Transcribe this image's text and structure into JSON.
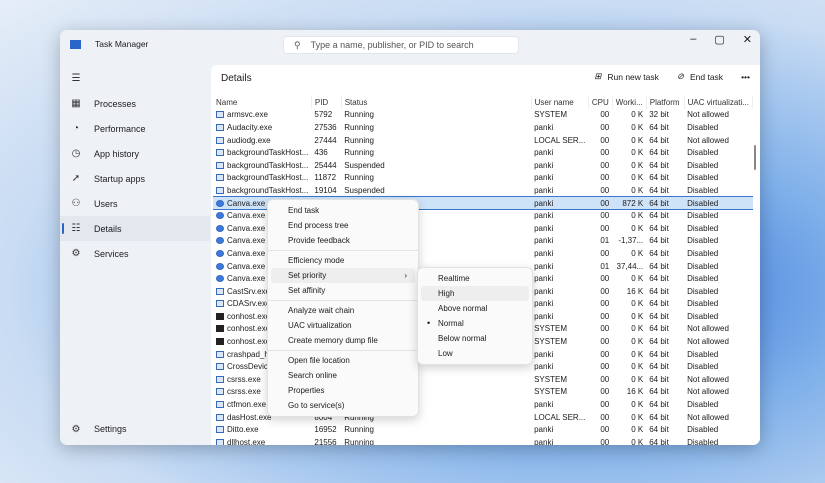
{
  "window": {
    "title": "Task Manager",
    "search_placeholder": "Type a name, publisher, or PID to search"
  },
  "sidebar": {
    "items": [
      {
        "label": "Processes",
        "icon": "grid-icon"
      },
      {
        "label": "Performance",
        "icon": "chart-icon"
      },
      {
        "label": "App history",
        "icon": "history-icon"
      },
      {
        "label": "Startup apps",
        "icon": "rocket-icon"
      },
      {
        "label": "Users",
        "icon": "users-icon"
      },
      {
        "label": "Details",
        "icon": "list-icon",
        "active": true
      },
      {
        "label": "Services",
        "icon": "gear-icon"
      }
    ],
    "settings": "Settings"
  },
  "main": {
    "title": "Details",
    "run_new_task": "Run new task",
    "end_task": "End task",
    "more": "•••"
  },
  "columns": [
    "Name",
    "PID",
    "Status",
    "User name",
    "CPU",
    "Worki...",
    "Platform",
    "UAC virtualizati..."
  ],
  "rows": [
    [
      "armsvc.exe",
      "5792",
      "Running",
      "SYSTEM",
      "00",
      "0 K",
      "32 bit",
      "Not allowed"
    ],
    [
      "Audacity.exe",
      "27536",
      "Running",
      "panki",
      "00",
      "0 K",
      "64 bit",
      "Disabled"
    ],
    [
      "audiodg.exe",
      "27444",
      "Running",
      "LOCAL SER...",
      "00",
      "0 K",
      "64 bit",
      "Not allowed"
    ],
    [
      "backgroundTaskHost...",
      "436",
      "Running",
      "panki",
      "00",
      "0 K",
      "64 bit",
      "Disabled"
    ],
    [
      "backgroundTaskHost...",
      "25444",
      "Suspended",
      "panki",
      "00",
      "0 K",
      "64 bit",
      "Disabled"
    ],
    [
      "backgroundTaskHost...",
      "11872",
      "Running",
      "panki",
      "00",
      "0 K",
      "64 bit",
      "Disabled"
    ],
    [
      "backgroundTaskHost...",
      "19104",
      "Suspended",
      "panki",
      "00",
      "0 K",
      "64 bit",
      "Disabled"
    ],
    [
      "Canva.exe",
      "",
      "",
      "panki",
      "00",
      "872 K",
      "64 bit",
      "Disabled"
    ],
    [
      "Canva.exe",
      "",
      "",
      "panki",
      "00",
      "0 K",
      "64 bit",
      "Disabled"
    ],
    [
      "Canva.exe",
      "",
      "",
      "panki",
      "00",
      "0 K",
      "64 bit",
      "Disabled"
    ],
    [
      "Canva.exe",
      "",
      "",
      "panki",
      "01",
      "-1,37...",
      "64 bit",
      "Disabled"
    ],
    [
      "Canva.exe",
      "",
      "",
      "panki",
      "00",
      "0 K",
      "64 bit",
      "Disabled"
    ],
    [
      "Canva.exe",
      "",
      "",
      "panki",
      "01",
      "37,44...",
      "64 bit",
      "Disabled"
    ],
    [
      "Canva.exe",
      "",
      "",
      "panki",
      "00",
      "0 K",
      "64 bit",
      "Disabled"
    ],
    [
      "CastSrv.exe",
      "",
      "",
      "panki",
      "00",
      "16 K",
      "64 bit",
      "Disabled"
    ],
    [
      "CDASrv.exe",
      "",
      "",
      "panki",
      "00",
      "0 K",
      "64 bit",
      "Disabled"
    ],
    [
      "conhost.exe",
      "",
      "",
      "panki",
      "00",
      "0 K",
      "64 bit",
      "Disabled"
    ],
    [
      "conhost.exe",
      "",
      "",
      "SYSTEM",
      "00",
      "0 K",
      "64 bit",
      "Not allowed"
    ],
    [
      "conhost.exe",
      "",
      "",
      "SYSTEM",
      "00",
      "0 K",
      "64 bit",
      "Not allowed"
    ],
    [
      "crashpad_h",
      "",
      "",
      "panki",
      "00",
      "0 K",
      "64 bit",
      "Disabled"
    ],
    [
      "CrossDevic",
      "",
      "",
      "panki",
      "00",
      "0 K",
      "64 bit",
      "Disabled"
    ],
    [
      "csrss.exe",
      "",
      "",
      "SYSTEM",
      "00",
      "0 K",
      "64 bit",
      "Not allowed"
    ],
    [
      "csrss.exe",
      "",
      "",
      "SYSTEM",
      "00",
      "16 K",
      "64 bit",
      "Not allowed"
    ],
    [
      "ctfmon.exe",
      "",
      "",
      "panki",
      "00",
      "0 K",
      "64 bit",
      "Disabled"
    ],
    [
      "dasHost.exe",
      "8004",
      "Running",
      "LOCAL SER...",
      "00",
      "0 K",
      "64 bit",
      "Not allowed"
    ],
    [
      "Ditto.exe",
      "16952",
      "Running",
      "panki",
      "00",
      "0 K",
      "64 bit",
      "Disabled"
    ],
    [
      "dllhost.exe",
      "21556",
      "Running",
      "panki",
      "00",
      "0 K",
      "64 bit",
      "Disabled"
    ]
  ],
  "context_menu": [
    [
      "End task",
      "End process tree",
      "Provide feedback"
    ],
    [
      "Efficiency mode",
      "Set priority",
      "Set affinity"
    ],
    [
      "Analyze wait chain",
      "UAC virtualization",
      "Create memory dump file"
    ],
    [
      "Open file location",
      "Search online",
      "Properties",
      "Go to service(s)"
    ]
  ],
  "priority_menu": {
    "items": [
      "Realtime",
      "High",
      "Above normal",
      "Normal",
      "Below normal",
      "Low"
    ],
    "selected": "Normal",
    "hovered": "High"
  }
}
